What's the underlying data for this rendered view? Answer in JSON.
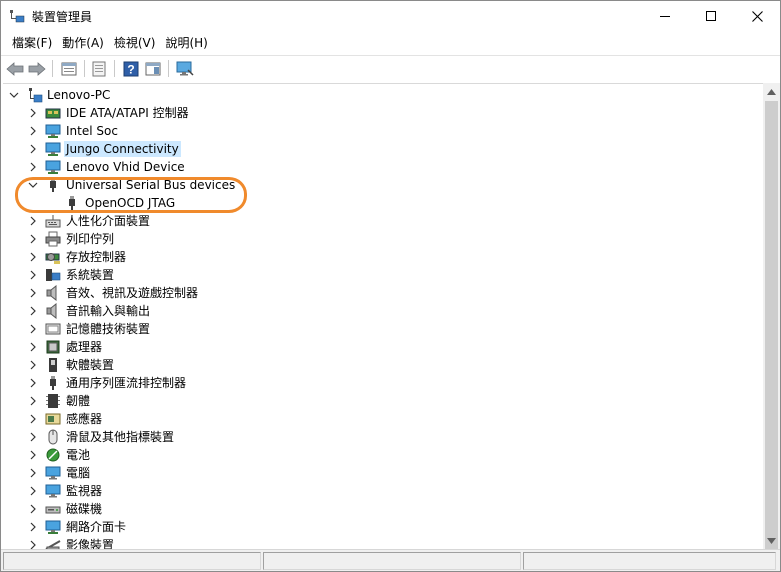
{
  "window": {
    "title": "裝置管理員",
    "controls": {
      "minimize": "minimize-icon",
      "maximize": "maximize-icon",
      "close": "close-icon"
    }
  },
  "menu": [
    {
      "label": "檔案(F)"
    },
    {
      "label": "動作(A)"
    },
    {
      "label": "檢視(V)"
    },
    {
      "label": "說明(H)"
    }
  ],
  "toolbar": {
    "buttons": [
      "back-icon",
      "forward-icon",
      "properties-view-icon",
      "show-hide-icon",
      "help-icon",
      "action-pane-icon",
      "scan-hardware-icon"
    ]
  },
  "tree": {
    "root": {
      "label": "Lenovo-PC",
      "expanded": true
    },
    "nodes": [
      {
        "label": "IDE ATA/ATAPI 控制器",
        "icon": "ide-controller-icon",
        "expanded": false
      },
      {
        "label": "Intel Soc",
        "icon": "monitor-network-icon",
        "expanded": false
      },
      {
        "label": "Jungo Connectivity",
        "icon": "monitor-network-icon",
        "expanded": false,
        "selected": true
      },
      {
        "label": "Lenovo Vhid Device",
        "icon": "monitor-network-icon",
        "expanded": false
      },
      {
        "label": "Universal Serial Bus devices",
        "icon": "usb-plug-icon",
        "expanded": true,
        "children": [
          {
            "label": "OpenOCD JTAG",
            "icon": "usb-plug-icon"
          }
        ]
      },
      {
        "label": "人性化介面裝置",
        "icon": "hid-icon",
        "expanded": false
      },
      {
        "label": "列印佇列",
        "icon": "printer-icon",
        "expanded": false
      },
      {
        "label": "存放控制器",
        "icon": "storage-controller-icon",
        "expanded": false
      },
      {
        "label": "系統裝置",
        "icon": "system-device-icon",
        "expanded": false
      },
      {
        "label": "音效、視訊及遊戲控制器",
        "icon": "speaker-icon",
        "expanded": false
      },
      {
        "label": "音訊輸入與輸出",
        "icon": "speaker-icon",
        "expanded": false
      },
      {
        "label": "記憶體技術裝置",
        "icon": "memory-device-icon",
        "expanded": false
      },
      {
        "label": "處理器",
        "icon": "processor-icon",
        "expanded": false
      },
      {
        "label": "軟體裝置",
        "icon": "software-device-icon",
        "expanded": false
      },
      {
        "label": "通用序列匯流排控制器",
        "icon": "usb-plug-icon",
        "expanded": false
      },
      {
        "label": "韌體",
        "icon": "firmware-icon",
        "expanded": false
      },
      {
        "label": "感應器",
        "icon": "sensor-icon",
        "expanded": false
      },
      {
        "label": "滑鼠及其他指標裝置",
        "icon": "mouse-icon",
        "expanded": false
      },
      {
        "label": "電池",
        "icon": "battery-icon",
        "expanded": false
      },
      {
        "label": "電腦",
        "icon": "computer-icon",
        "expanded": false
      },
      {
        "label": "監視器",
        "icon": "monitor-icon",
        "expanded": false
      },
      {
        "label": "磁碟機",
        "icon": "disk-drive-icon",
        "expanded": false
      },
      {
        "label": "網路介面卡",
        "icon": "network-adapter-icon",
        "expanded": false
      },
      {
        "label": "影像裝置",
        "icon": "imaging-device-icon",
        "expanded": false
      }
    ]
  },
  "colors": {
    "selection": "#cce8ff",
    "highlight_ring": "#f08a2c"
  }
}
